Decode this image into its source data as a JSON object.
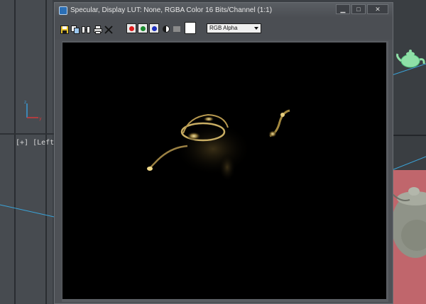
{
  "viewport": {
    "label": "[+] [Left] [",
    "colors": {
      "background": "#3b3f44",
      "floor": "#c0666c",
      "selection_line": "#3aa3d8"
    }
  },
  "render_window": {
    "title": "Specular, Display LUT: None, RGBA Color 16 Bits/Channel (1:1)",
    "controls": {
      "minimize": "▁",
      "maximize": "□",
      "close": "✕"
    },
    "toolbar": {
      "icons": [
        "save-icon",
        "copy-icon",
        "clone-icon",
        "print-icon",
        "clear-icon"
      ],
      "channels": [
        {
          "name": "red-channel",
          "color": "#e01b1b"
        },
        {
          "name": "green-channel",
          "color": "#1a8a2e"
        },
        {
          "name": "blue-channel",
          "color": "#1d2fbd"
        }
      ],
      "channel_select": {
        "value": "RGB Alpha"
      }
    },
    "image_background": "#000000"
  }
}
